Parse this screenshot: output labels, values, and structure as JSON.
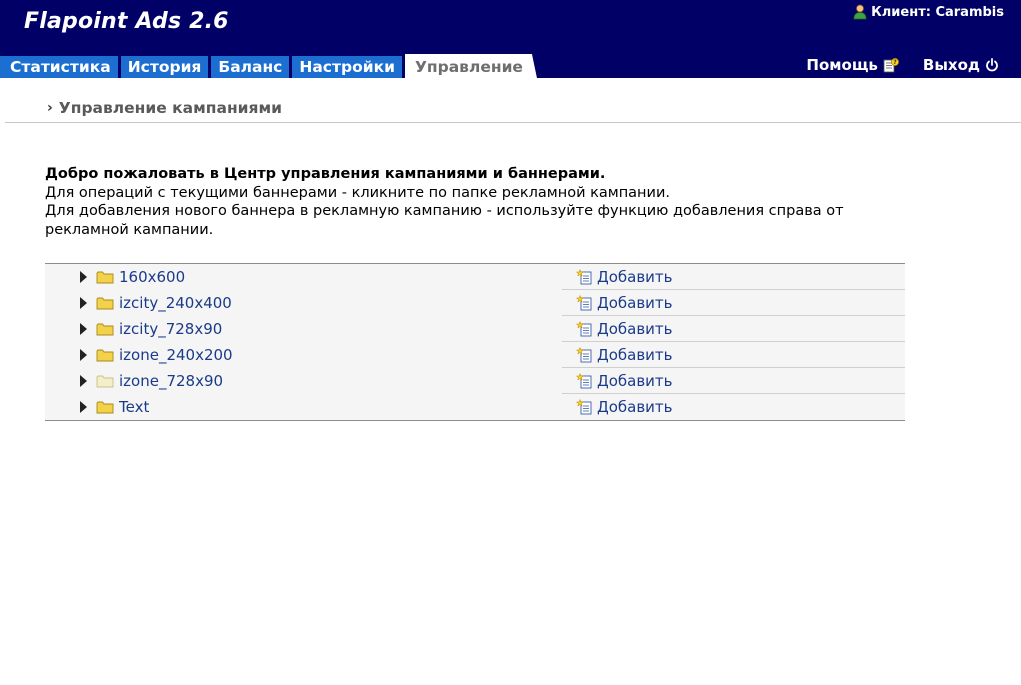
{
  "header": {
    "app_title": "Flapoint Ads 2.6",
    "client_label": "Клиент: Carambis",
    "tabs": [
      {
        "label": "Статистика",
        "active": false
      },
      {
        "label": "История",
        "active": false
      },
      {
        "label": "Баланс",
        "active": false
      },
      {
        "label": "Настройки",
        "active": false
      },
      {
        "label": "Управление",
        "active": true
      }
    ],
    "help_label": "Помощь",
    "exit_label": "Выход"
  },
  "breadcrumb": {
    "arrow": "›",
    "title": "Управление кампаниями"
  },
  "intro": {
    "welcome": "Добро пожаловать в Центр управления кампаниями и баннерами.",
    "line1": "Для операций с текущими баннерами - кликните по папке рекламной кампании.",
    "line2": "Для добавления нового баннера в рекламную кампанию - используйте функцию добавления справа от рекламной кампании."
  },
  "campaigns": [
    {
      "name": "160x600",
      "add_label": "Добавить",
      "folder_color": "#f3d24a"
    },
    {
      "name": "izcity_240x400",
      "add_label": "Добавить",
      "folder_color": "#f3d24a"
    },
    {
      "name": "izcity_728x90",
      "add_label": "Добавить",
      "folder_color": "#f3d24a"
    },
    {
      "name": "izone_240x200",
      "add_label": "Добавить",
      "folder_color": "#f3d24a"
    },
    {
      "name": "izone_728x90",
      "add_label": "Добавить",
      "folder_color": "#f4efc9"
    },
    {
      "name": "Text",
      "add_label": "Добавить",
      "folder_color": "#f3d24a"
    }
  ],
  "colors": {
    "header_bg": "#000066",
    "tab_bg": "#1c6fd0",
    "link": "#1a3a8a"
  }
}
